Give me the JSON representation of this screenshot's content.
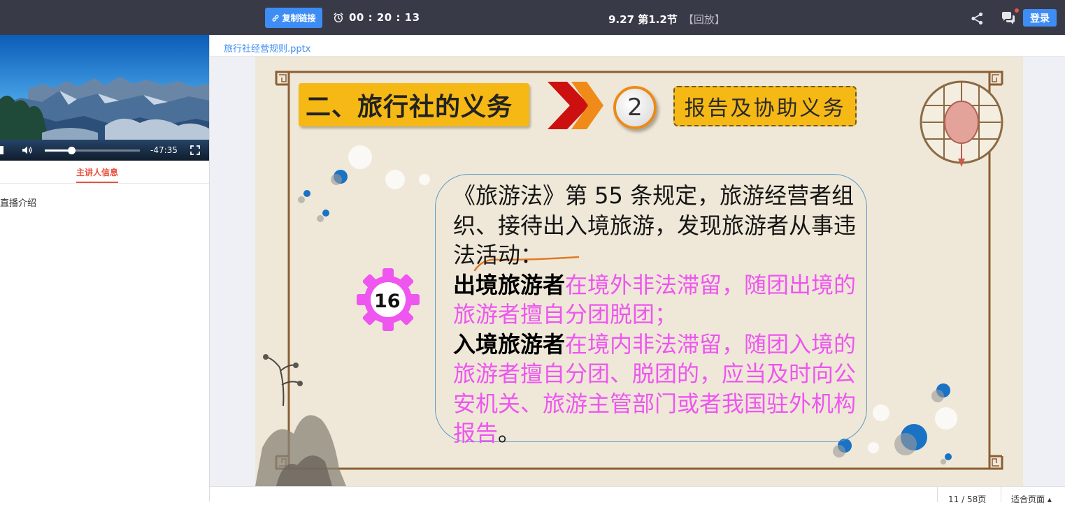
{
  "header": {
    "copy_link_label": "复制链接",
    "timer": "00 : 20 : 13",
    "session_title": "9.27  第1.2节",
    "replay_tag": "【回放】",
    "login_label": "登录",
    "icons": [
      "link-icon",
      "alarm-clock-icon",
      "share-icon",
      "chat-icon"
    ]
  },
  "video": {
    "remaining_time": "-47:35",
    "progress_fraction": 0.28,
    "icons": [
      "play-icon",
      "volume-icon",
      "fullscreen-icon"
    ]
  },
  "left_panel": {
    "tab_host_info": "主讲人信息",
    "live_intro": "直播介绍"
  },
  "document": {
    "filename": "旅行社经营规则.pptx",
    "page_current": "11",
    "page_total": "58页",
    "fit_label": "适合页面 ▴"
  },
  "slide": {
    "title": "二、旅行社的义务",
    "number": "2",
    "subtitle": "报告及协助义务",
    "gear_number": "16",
    "para_intro": "《旅游法》第 55 条规定，旅游经营者组织、接待出入境旅游，发现旅游者从事违法活动：",
    "outbound_label": "出境旅游者",
    "outbound_text": "在境外非法滞留，随团出境的旅游者擅自分团脱团；",
    "inbound_label": "入境旅游者",
    "inbound_text": "在境内非法滞留，随团入境的旅游者擅自分团、脱团的，应当及时向公安机关、旅游主管部门或者我国驻外机构报告",
    "ending": "。",
    "colors": {
      "title_bg": "#f5b814",
      "arrow_red": "#cc1010",
      "arrow_orange": "#f08a18",
      "gear": "#ee56ef",
      "pink_text": "#ee56ef",
      "border_brown": "#8b5e34",
      "dot_blue": "#1a72c4"
    }
  },
  "colors": {
    "topbar_bg": "#393a48",
    "button_blue": "#3d8df5",
    "active_tab": "#e8503c"
  }
}
